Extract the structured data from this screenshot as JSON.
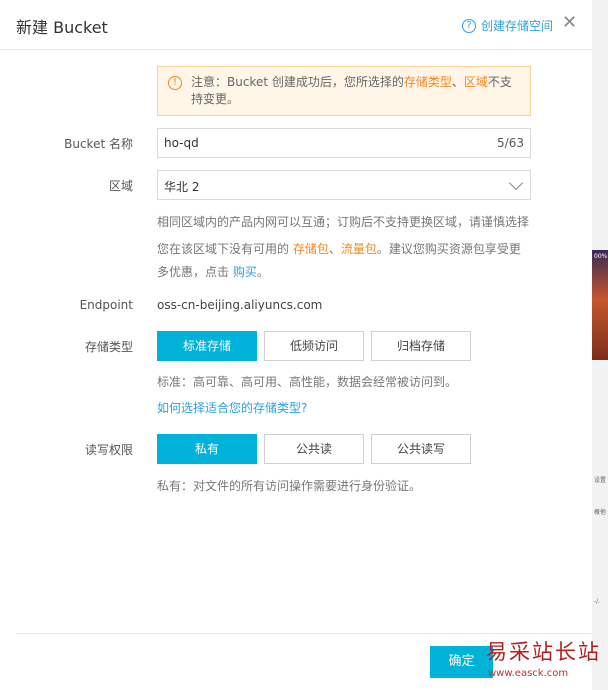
{
  "dialog": {
    "title": "新建 Bucket",
    "help_icon": "?",
    "help_link": "创建存储空间",
    "close_icon": "✕"
  },
  "notice": {
    "icon": "!",
    "text_prefix": "注意：Bucket 创建成功后，您所选择的",
    "storage_type": "存储类型",
    "separator": "、",
    "region": "区域",
    "text_suffix": "不支持变更。"
  },
  "form": {
    "bucket_name": {
      "label": "Bucket 名称",
      "value": "ho-qd",
      "count": "5/63"
    },
    "region": {
      "label": "区域",
      "value": "华北 2",
      "hint_line1": "相同区域内的产品内网可以互通；订购后不支持更换区域，请谨慎选择",
      "hint_line2_prefix": "您在该区域下没有可用的",
      "storage_pack": "存储包",
      "sep": "、",
      "traffic_pack": "流量包",
      "hint_line2_suffix": "。建议您购买资源包享受更",
      "hint_line3_prefix": "多优惠，点击",
      "buy_link": "购买",
      "hint_line3_suffix": "。"
    },
    "endpoint": {
      "label": "Endpoint",
      "value": "oss-cn-beijing.aliyuncs.com"
    },
    "storage_class": {
      "label": "存储类型",
      "options": [
        "标准存储",
        "低频访问",
        "归档存储"
      ],
      "selected": "标准存储",
      "hint": "标准：高可靠、高可用、高性能，数据会经常被访问到。",
      "help_link": "如何选择适合您的存储类型?"
    },
    "acl": {
      "label": "读写权限",
      "options": [
        "私有",
        "公共读",
        "公共读写"
      ],
      "selected": "私有",
      "hint": "私有：对文件的所有访问操作需要进行身份验证。"
    }
  },
  "footer": {
    "ok_label": "确定"
  },
  "side": {
    "pct": "00%",
    "t1": "设置",
    "t2": "概他",
    "t3": "-/."
  },
  "watermark": {
    "text": "易采站长站",
    "url": "www.easck.com"
  },
  "colors": {
    "accent": "#00b1d8",
    "link": "#2fa0e0",
    "warning": "#f08a24"
  }
}
